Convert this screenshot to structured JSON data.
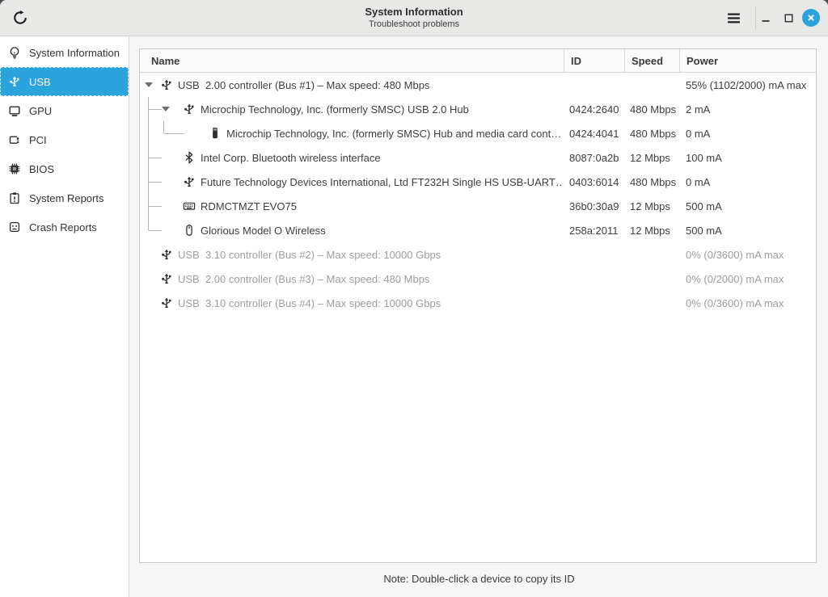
{
  "window": {
    "title": "System Information",
    "subtitle": "Troubleshoot problems"
  },
  "icons": {
    "refresh": "circular-clockwise-arrow",
    "menu": "hamburger-three-bars",
    "minimize": "underscore-dash",
    "maximize": "square-outline",
    "close": "x-in-blue-circle",
    "lightbulb": "lightbulb-outline",
    "usb": "usb-trident",
    "monitor": "display-outline",
    "pci": "expansion-card",
    "chip": "bios-chip",
    "clipboard": "clipboard-exclamation",
    "sadface": "sad-face-square",
    "usbstick": "usb-flash-drive",
    "bluetooth": "bluetooth-rune",
    "keyboard": "keyboard-keys",
    "mouse": "computer-mouse"
  },
  "colors": {
    "accent": "#2ba3dc",
    "selected_bg": "#2b9ed8",
    "grey_text": "#9e9e9e",
    "tree_guide": "#b3b3b3",
    "titlebar_bg": "#e8e8e7",
    "main_bg": "#f6f6f6"
  },
  "sidebar": {
    "items": [
      {
        "label": "System Information",
        "icon": "lightbulb",
        "selected": false
      },
      {
        "label": "USB",
        "icon": "usb",
        "selected": true
      },
      {
        "label": "GPU",
        "icon": "monitor",
        "selected": false
      },
      {
        "label": "PCI",
        "icon": "pci",
        "selected": false
      },
      {
        "label": "BIOS",
        "icon": "chip",
        "selected": false
      },
      {
        "label": "System Reports",
        "icon": "clipboard",
        "selected": false
      },
      {
        "label": "Crash Reports",
        "icon": "sadface",
        "selected": false
      }
    ]
  },
  "table": {
    "columns": [
      "Name",
      "ID",
      "Speed",
      "Power"
    ],
    "rows": [
      {
        "name": "USB  2.00 controller (Bus #1) – Max speed: 480 Mbps",
        "id": "",
        "speed": "",
        "power": "55% (1102/2000) mA max",
        "icon": "usb",
        "depth": 0,
        "expanded": true,
        "connector": null,
        "ancestor_line": false,
        "grey": false
      },
      {
        "name": "Microchip Technology, Inc. (formerly SMSC) USB 2.0 Hub",
        "id": "0424:2640",
        "speed": "480 Mbps",
        "power": "2 mA",
        "icon": "usb",
        "depth": 1,
        "expanded": true,
        "connector": "tee",
        "ancestor_line": false,
        "grey": false
      },
      {
        "name": "Microchip Technology, Inc. (formerly SMSC) Hub and media card cont…",
        "id": "0424:4041",
        "speed": "480 Mbps",
        "power": "0 mA",
        "icon": "usbstick",
        "depth": 2,
        "expanded": false,
        "connector": "elbow",
        "ancestor_line": true,
        "grey": false
      },
      {
        "name": "Intel Corp. Bluetooth wireless interface",
        "id": "8087:0a2b",
        "speed": "12 Mbps",
        "power": "100 mA",
        "icon": "bluetooth",
        "depth": 1,
        "expanded": false,
        "connector": "tee",
        "ancestor_line": false,
        "grey": false
      },
      {
        "name": "Future Technology Devices International, Ltd FT232H Single HS USB-UART…",
        "id": "0403:6014",
        "speed": "480 Mbps",
        "power": "0 mA",
        "icon": "usb",
        "depth": 1,
        "expanded": false,
        "connector": "tee",
        "ancestor_line": false,
        "grey": false
      },
      {
        "name": "RDMCTMZT EVO75",
        "id": "36b0:30a9",
        "speed": "12 Mbps",
        "power": "500 mA",
        "icon": "keyboard",
        "depth": 1,
        "expanded": false,
        "connector": "tee",
        "ancestor_line": false,
        "grey": false
      },
      {
        "name": "Glorious Model O Wireless",
        "id": "258a:2011",
        "speed": "12 Mbps",
        "power": "500 mA",
        "icon": "mouse",
        "depth": 1,
        "expanded": false,
        "connector": "elbow",
        "ancestor_line": false,
        "grey": false
      },
      {
        "name": "USB  3.10 controller (Bus #2) – Max speed: 10000 Gbps",
        "id": "",
        "speed": "",
        "power": "0% (0/3600) mA max",
        "icon": "usb",
        "depth": 0,
        "expanded": false,
        "connector": null,
        "ancestor_line": false,
        "grey": true
      },
      {
        "name": "USB  2.00 controller (Bus #3) – Max speed: 480 Mbps",
        "id": "",
        "speed": "",
        "power": "0% (0/2000) mA max",
        "icon": "usb",
        "depth": 0,
        "expanded": false,
        "connector": null,
        "ancestor_line": false,
        "grey": true
      },
      {
        "name": "USB  3.10 controller (Bus #4) – Max speed: 10000 Gbps",
        "id": "",
        "speed": "",
        "power": "0% (0/3600) mA max",
        "icon": "usb",
        "depth": 0,
        "expanded": false,
        "connector": null,
        "ancestor_line": false,
        "grey": true
      }
    ]
  },
  "footer": {
    "note": "Note: Double-click a device to copy its ID"
  }
}
